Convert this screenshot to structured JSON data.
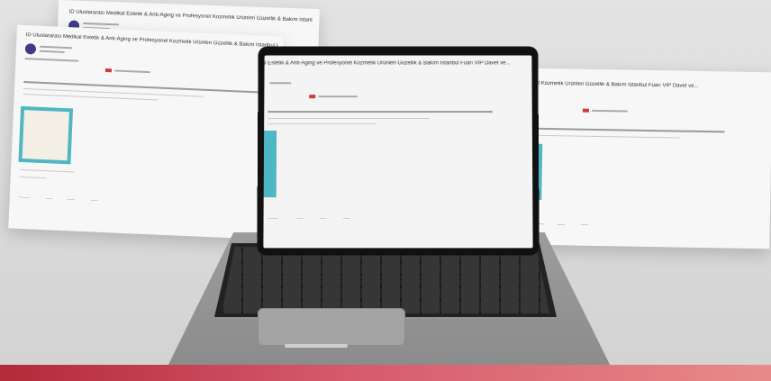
{
  "email": {
    "subject": "ID Uluslararası Medikal Estetik & Anti-Aging ve Profesyonel Kozmetik Ürünleri Güzellik & Bakım İstanbul Fuarı VIP Davet ve..."
  },
  "scene": {
    "colors": {
      "background": "#dcdcdc",
      "accent_bar": "#c23b4b",
      "thumbnail": "#4fb6c4",
      "avatar": "#3f3a8c",
      "laptop": "#8f8f8f"
    }
  }
}
